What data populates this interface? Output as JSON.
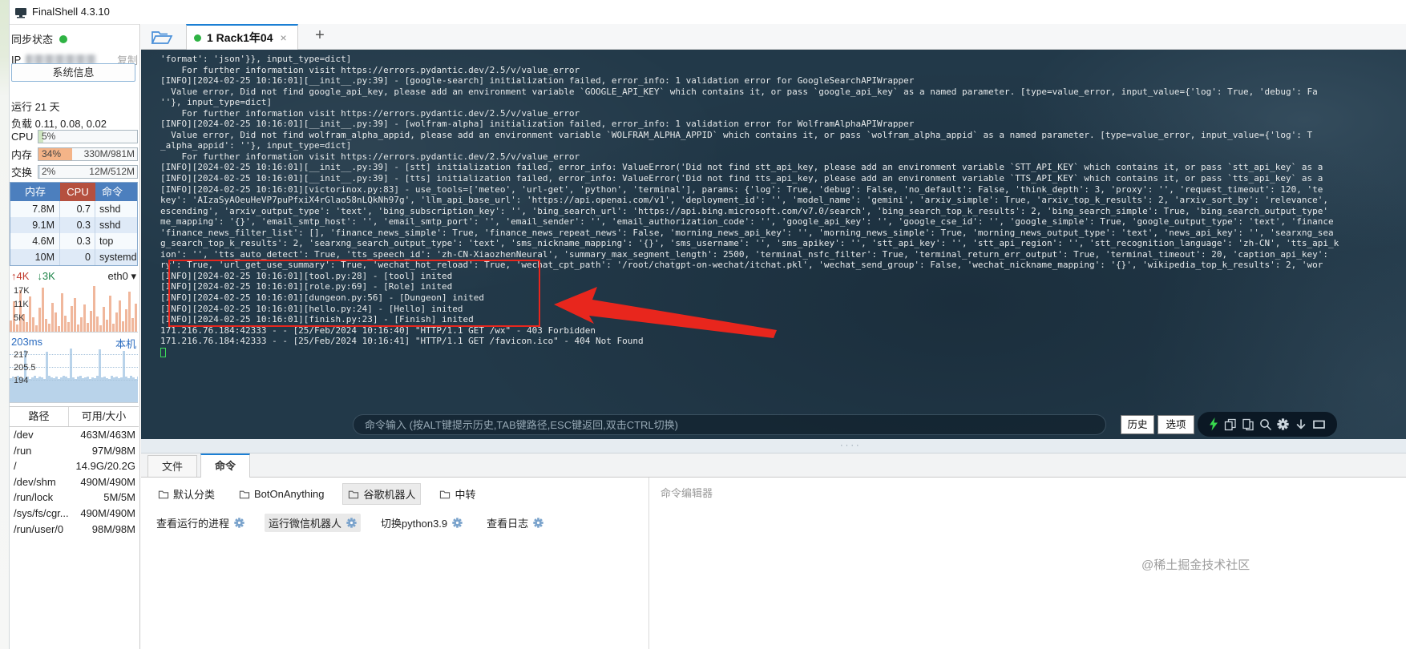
{
  "window": {
    "title": "FinalShell 4.3.10"
  },
  "colors": {
    "accent_blue": "#1b7fd4",
    "header_blue": "#4c7fbe",
    "header_red": "#b5503f",
    "terminal_bg": "#223949",
    "annotation_red": "#e8261d",
    "net_bar": "#f0b79c",
    "ping_bar": "#b9d3ea",
    "mem_fill": "#f4b488",
    "cpu_fill": "#cfe6c2",
    "swap_fill": "#d3dfe9",
    "green_dot": "#2fb344",
    "lightning_green": "#38d94d"
  },
  "sidebar": {
    "sync_label": "同步状态",
    "ip_label": "IP",
    "copy_label": "复制",
    "sysinfo_button": "系统信息",
    "uptime": "运行 21 天",
    "load": "负载 0.11, 0.08, 0.02",
    "cpu": {
      "label": "CPU",
      "percent": "5%",
      "value": ""
    },
    "mem": {
      "label": "内存",
      "percent": "34%",
      "value": "330M/981M"
    },
    "swap": {
      "label": "交换",
      "percent": "2%",
      "value": "12M/512M"
    },
    "process_table": {
      "headers": [
        "内存",
        "CPU",
        "命令"
      ],
      "rows": [
        [
          "7.8M",
          "0.7",
          "sshd"
        ],
        [
          "9.1M",
          "0.3",
          "sshd"
        ],
        [
          "4.6M",
          "0.3",
          "top"
        ],
        [
          "10M",
          "0",
          "systemd"
        ]
      ]
    },
    "network": {
      "up": "4K",
      "down": "3K",
      "iface": "eth0",
      "iface_caret": "▾",
      "up_arrow": "↑",
      "down_arrow": "↓",
      "yticks": [
        "17K",
        "11K",
        "5K"
      ],
      "bars": [
        14,
        38,
        9,
        52,
        22,
        12,
        44,
        18,
        8,
        30,
        55,
        16,
        10,
        36,
        24,
        7,
        48,
        20,
        12,
        32,
        42,
        9,
        18,
        34,
        11,
        26,
        57,
        19,
        8,
        31,
        15,
        45,
        10,
        24,
        39,
        13,
        28,
        50,
        17,
        35
      ]
    },
    "ping": {
      "latency": "203ms",
      "host": "本机",
      "yticks": [
        "217",
        "205.5",
        "194"
      ],
      "bars": [
        30,
        32,
        29,
        33,
        31,
        30,
        65,
        32,
        29,
        31,
        33,
        30,
        32,
        31,
        29,
        63,
        33,
        31,
        30,
        32,
        29,
        31,
        33,
        32,
        30,
        67,
        31,
        29,
        32,
        33,
        30,
        31,
        32,
        29,
        31,
        30,
        33,
        66,
        31,
        32,
        30,
        29,
        33,
        31,
        32,
        30,
        31,
        64,
        32,
        30,
        33,
        31,
        29,
        32
      ]
    },
    "disk_table": {
      "headers": [
        "路径",
        "可用/大小"
      ],
      "rows": [
        [
          "/dev",
          "463M/463M"
        ],
        [
          "/run",
          "97M/98M"
        ],
        [
          "/",
          "14.9G/20.2G"
        ],
        [
          "/dev/shm",
          "490M/490M"
        ],
        [
          "/run/lock",
          "5M/5M"
        ],
        [
          "/sys/fs/cgr...",
          "490M/490M"
        ],
        [
          "/run/user/0",
          "98M/98M"
        ]
      ]
    }
  },
  "tabbar": {
    "tab_label": "1 Rack1年04",
    "close": "×",
    "new_tab": "+"
  },
  "terminal": {
    "lines": [
      "'format': 'json'}}, input_type=dict]",
      "    For further information visit https://errors.pydantic.dev/2.5/v/value_error",
      "[INFO][2024-02-25 10:16:01][__init__.py:39] - [google-search] initialization failed, error_info: 1 validation error for GoogleSearchAPIWrapper",
      "  Value error, Did not find google_api_key, please add an environment variable `GOOGLE_API_KEY` which contains it, or pass `google_api_key` as a named parameter. [type=value_error, input_value={'log': True, 'debug': Fa",
      "''}, input_type=dict]",
      "    For further information visit https://errors.pydantic.dev/2.5/v/value_error",
      "[INFO][2024-02-25 10:16:01][__init__.py:39] - [wolfram-alpha] initialization failed, error_info: 1 validation error for WolframAlphaAPIWrapper",
      "  Value error, Did not find wolfram_alpha_appid, please add an environment variable `WOLFRAM_ALPHA_APPID` which contains it, or pass `wolfram_alpha_appid` as a named parameter. [type=value_error, input_value={'log': T",
      "_alpha_appid': ''}, input_type=dict]",
      "    For further information visit https://errors.pydantic.dev/2.5/v/value_error",
      "[INFO][2024-02-25 10:16:01][__init__.py:39] - [stt] initialization failed, error_info: ValueError('Did not find stt_api_key, please add an environment variable `STT_API_KEY` which contains it, or pass `stt_api_key` as a",
      "[INFO][2024-02-25 10:16:01][__init__.py:39] - [tts] initialization failed, error_info: ValueError('Did not find tts_api_key, please add an environment variable `TTS_API_KEY` which contains it, or pass `tts_api_key` as a",
      "[INFO][2024-02-25 10:16:01][victorinox.py:83] - use_tools=['meteo', 'url-get', 'python', 'terminal'], params: {'log': True, 'debug': False, 'no_default': False, 'think_depth': 3, 'proxy': '', 'request_timeout': 120, 'te",
      "key': 'AIzaSyAOeuHeVP7puPfxiX4rGlao58nLQkNh97g', 'llm_api_base_url': 'https://api.openai.com/v1', 'deployment_id': '', 'model_name': 'gemini', 'arxiv_simple': True, 'arxiv_top_k_results': 2, 'arxiv_sort_by': 'relevance',",
      "escending', 'arxiv_output_type': 'text', 'bing_subscription_key': '', 'bing_search_url': 'https://api.bing.microsoft.com/v7.0/search', 'bing_search_top_k_results': 2, 'bing_search_simple': True, 'bing_search_output_type'",
      "me_mapping': '{}', 'email_smtp_host': '', 'email_smtp_port': '', 'email_sender': '', 'email_authorization_code': '', 'google_api_key': '', 'google_cse_id': '', 'google_simple': True, 'google_output_type': 'text', 'finance",
      "'finance_news_filter_list': [], 'finance_news_simple': True, 'finance_news_repeat_news': False, 'morning_news_api_key': '', 'morning_news_simple': True, 'morning_news_output_type': 'text', 'news_api_key': '', 'searxng_sea",
      "g_search_top_k_results': 2, 'searxng_search_output_type': 'text', 'sms_nickname_mapping': '{}', 'sms_username': '', 'sms_apikey': '', 'stt_api_key': '', 'stt_api_region': '', 'stt_recognition_language': 'zh-CN', 'tts_api_k",
      "ion': '', 'tts_auto_detect': True, 'tts_speech_id': 'zh-CN-XiaozhenNeural', 'summary_max_segment_length': 2500, 'terminal_nsfc_filter': True, 'terminal_return_err_output': True, 'terminal_timeout': 20, 'caption_api_key':",
      "ry': True, 'url_get_use_summary': True, 'wechat_hot_reload': True, 'wechat_cpt_path': '/root/chatgpt-on-wechat/itchat.pkl', 'wechat_send_group': False, 'wechat_nickname_mapping': '{}', 'wikipedia_top_k_results': 2, 'wor",
      "[INFO][2024-02-25 10:16:01][tool.py:28] - [tool] inited",
      "[INFO][2024-02-25 10:16:01][role.py:69] - [Role] inited",
      "[INFO][2024-02-25 10:16:01][dungeon.py:56] - [Dungeon] inited",
      "[INFO][2024-02-25 10:16:01][hello.py:24] - [Hello] inited",
      "[INFO][2024-02-25 10:16:01][finish.py:23] - [Finish] inited",
      "171.216.76.184:42333 - - [25/Feb/2024 10:16:40] \"HTTP/1.1 GET /wx\" - 403 Forbidden",
      "171.216.76.184:42333 - - [25/Feb/2024 10:16:41] \"HTTP/1.1 GET /favicon.ico\" - 404 Not Found"
    ]
  },
  "command_bar": {
    "placeholder": "命令输入 (按ALT键提示历史,TAB键路径,ESC键返回,双击CTRL切换)",
    "history_button": "历史",
    "options_button": "选项"
  },
  "splitter_handle": "····",
  "bottom_panel": {
    "tabs": [
      "文件",
      "命令"
    ],
    "active_tab": 1,
    "folders": [
      "默认分类",
      "BotOnAnything",
      "谷歌机器人",
      "中转"
    ],
    "active_folder": 2,
    "commands": [
      "查看运行的进程",
      "运行微信机器人",
      "切换python3.9",
      "查看日志"
    ],
    "active_command": 1,
    "editor_title": "命令编辑器"
  },
  "watermark": "@稀土掘金技术社区"
}
